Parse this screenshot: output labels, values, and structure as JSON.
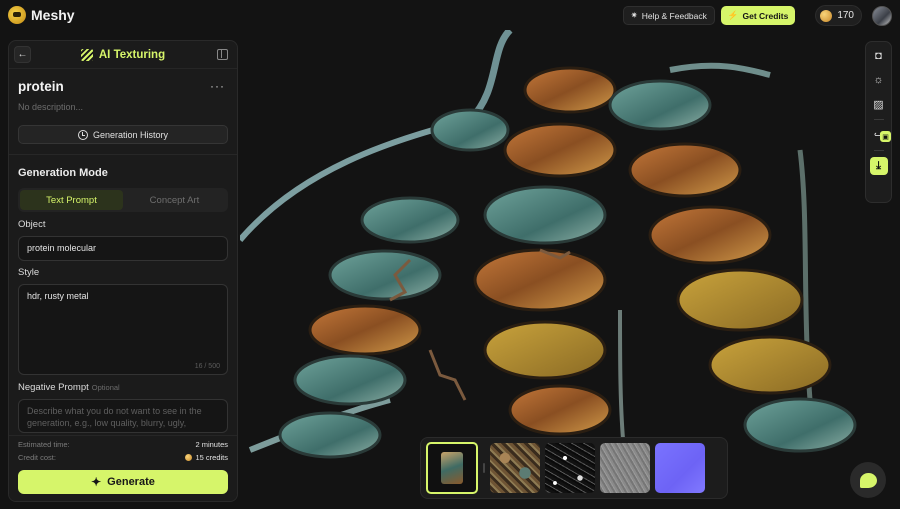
{
  "app": {
    "name": "Meshy"
  },
  "header": {
    "feedback_label": "Help & Feedback",
    "get_credits_label": "Get Credits",
    "credit_balance": "170"
  },
  "panel": {
    "title": "AI Texturing",
    "project_name": "protein",
    "project_description": "No description...",
    "more_label": "···",
    "history_label": "Generation History",
    "mode_title": "Generation Mode",
    "tabs": [
      {
        "label": "Text Prompt",
        "active": true
      },
      {
        "label": "Concept Art",
        "active": false
      }
    ],
    "object_label": "Object",
    "object_value": "protein molecular",
    "style_label": "Style",
    "style_value": "hdr, rusty metal",
    "style_count": "16 / 500",
    "negative_label": "Negative Prompt",
    "negative_optional": "Optional",
    "negative_placeholder": "Describe what you do not want to see in the generation, e.g., low quality, blurry, ugly,",
    "estimated_time_label": "Estimated time:",
    "estimated_time_value": "2 minutes",
    "credit_cost_label": "Credit cost:",
    "credit_cost_value": "15 credits",
    "generate_label": "Generate"
  },
  "toolbar": {
    "tools": [
      "camera-icon",
      "light-icon",
      "texture-icon",
      "share-icon",
      "download-icon"
    ]
  },
  "textures": {
    "items": [
      "model-preview",
      "base-color",
      "roughness",
      "metallic",
      "normal"
    ],
    "selected": "model-preview"
  },
  "colors": {
    "accent": "#d6f56a",
    "background": "#131313",
    "panel": "#1b1b1b"
  }
}
